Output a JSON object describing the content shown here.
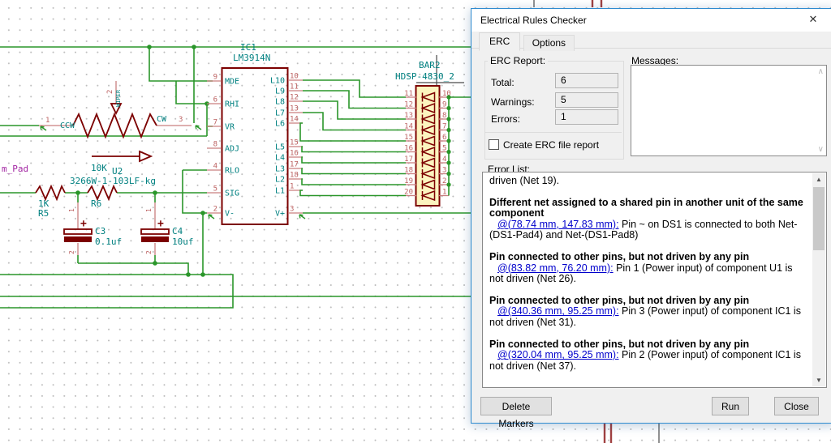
{
  "dialog": {
    "title": "Electrical Rules Checker",
    "close_icon": "✕",
    "tabs": [
      {
        "label": "ERC"
      },
      {
        "label": "Options"
      }
    ],
    "erc_report": {
      "group_label": "ERC Report:",
      "fields": [
        {
          "label": "Total:",
          "value": "6"
        },
        {
          "label": "Warnings:",
          "value": "5"
        },
        {
          "label": "Errors:",
          "value": "1"
        }
      ],
      "checkbox_label": "Create ERC file report",
      "checkbox_checked": false
    },
    "messages_label": "Messages:",
    "error_list": {
      "label": "Error List:",
      "entries": [
        {
          "text": "driven (Net 19)."
        },
        {
          "heading": "Different net assigned to a shared pin in another unit of the same component",
          "link": "@(78.74 mm, 147.83 mm):",
          "rest": " Pin ~ on DS1 is connected to both Net-(DS1-Pad4) and Net-(DS1-Pad8)"
        },
        {
          "heading": "Pin connected to other pins, but not driven by any pin",
          "link": "@(83.82 mm, 76.20 mm):",
          "rest": " Pin 1 (Power input) of component U1 is not driven (Net 26)."
        },
        {
          "heading": "Pin connected to other pins, but not driven by any pin",
          "link": "@(340.36 mm, 95.25 mm):",
          "rest": " Pin 3 (Power input) of component IC1 is not driven (Net 31)."
        },
        {
          "heading": "Pin connected to other pins, but not driven by any pin",
          "link": "@(320.04 mm, 95.25 mm):",
          "rest": " Pin 2 (Power input) of component IC1 is not driven (Net 37)."
        }
      ]
    },
    "buttons": {
      "delete_markers": "Delete Markers",
      "run": "Run",
      "close": "Close"
    }
  },
  "schematic": {
    "ic": {
      "ref": "IC1",
      "value": "LM3914N",
      "left_pins": [
        {
          "num": "9",
          "name": "MDE"
        },
        {
          "num": "6",
          "name": "RHI"
        },
        {
          "num": "7",
          "name": "VR"
        },
        {
          "num": "8",
          "name": "ADJ"
        },
        {
          "num": "4",
          "name": "RLO"
        },
        {
          "num": "5",
          "name": "SIG"
        },
        {
          "num": "2",
          "name": "V-"
        }
      ],
      "right_pins": [
        {
          "num": "10",
          "name": "L10"
        },
        {
          "num": "11",
          "name": "L9"
        },
        {
          "num": "12",
          "name": "L8"
        },
        {
          "num": "13",
          "name": "L7"
        },
        {
          "num": "14",
          "name": "L6"
        },
        {
          "num": "15",
          "name": "L5"
        },
        {
          "num": "16",
          "name": "L4"
        },
        {
          "num": "17",
          "name": "L3"
        },
        {
          "num": "18",
          "name": "L2"
        },
        {
          "num": "1",
          "name": "L1"
        },
        {
          "num": "3",
          "name": "V+"
        }
      ]
    },
    "bargraph": {
      "ref": "BAR2",
      "value": "HDSP-4830_2",
      "left_pin_numbers": [
        "11",
        "12",
        "13",
        "14",
        "15",
        "16",
        "17",
        "18",
        "19",
        "20"
      ],
      "right_pin_numbers": [
        "10",
        "9",
        "8",
        "7",
        "6",
        "5",
        "4",
        "3",
        "2",
        "1"
      ]
    },
    "potentiometer": {
      "ref": "U2",
      "resistance": "10K",
      "value": "3266W-1-103LF-kg",
      "pin1": "1",
      "pin2": "2",
      "pin3": "3",
      "ccw": "CCW",
      "cw": "CW",
      "wiper": "WIPER"
    },
    "r5": {
      "ref": "R5",
      "value": "1K"
    },
    "r6": {
      "ref": "R6"
    },
    "c3": {
      "ref": "C3",
      "value": "0.1uf",
      "plus": "+",
      "pin1": "1",
      "pin2": "2"
    },
    "c4": {
      "ref": "C4",
      "value": "10uf",
      "plus": "+",
      "pin1": "1",
      "pin2": "2"
    },
    "net_label": "m_Pad",
    "colors": {
      "wire": "#2a962a",
      "component": "#7c0000",
      "text": "#008080",
      "pin_number": "#bc6060",
      "net_label": "#a326a3",
      "bar_fill": "#fcf4bf",
      "dialog_border": "#2e8bd0"
    }
  }
}
